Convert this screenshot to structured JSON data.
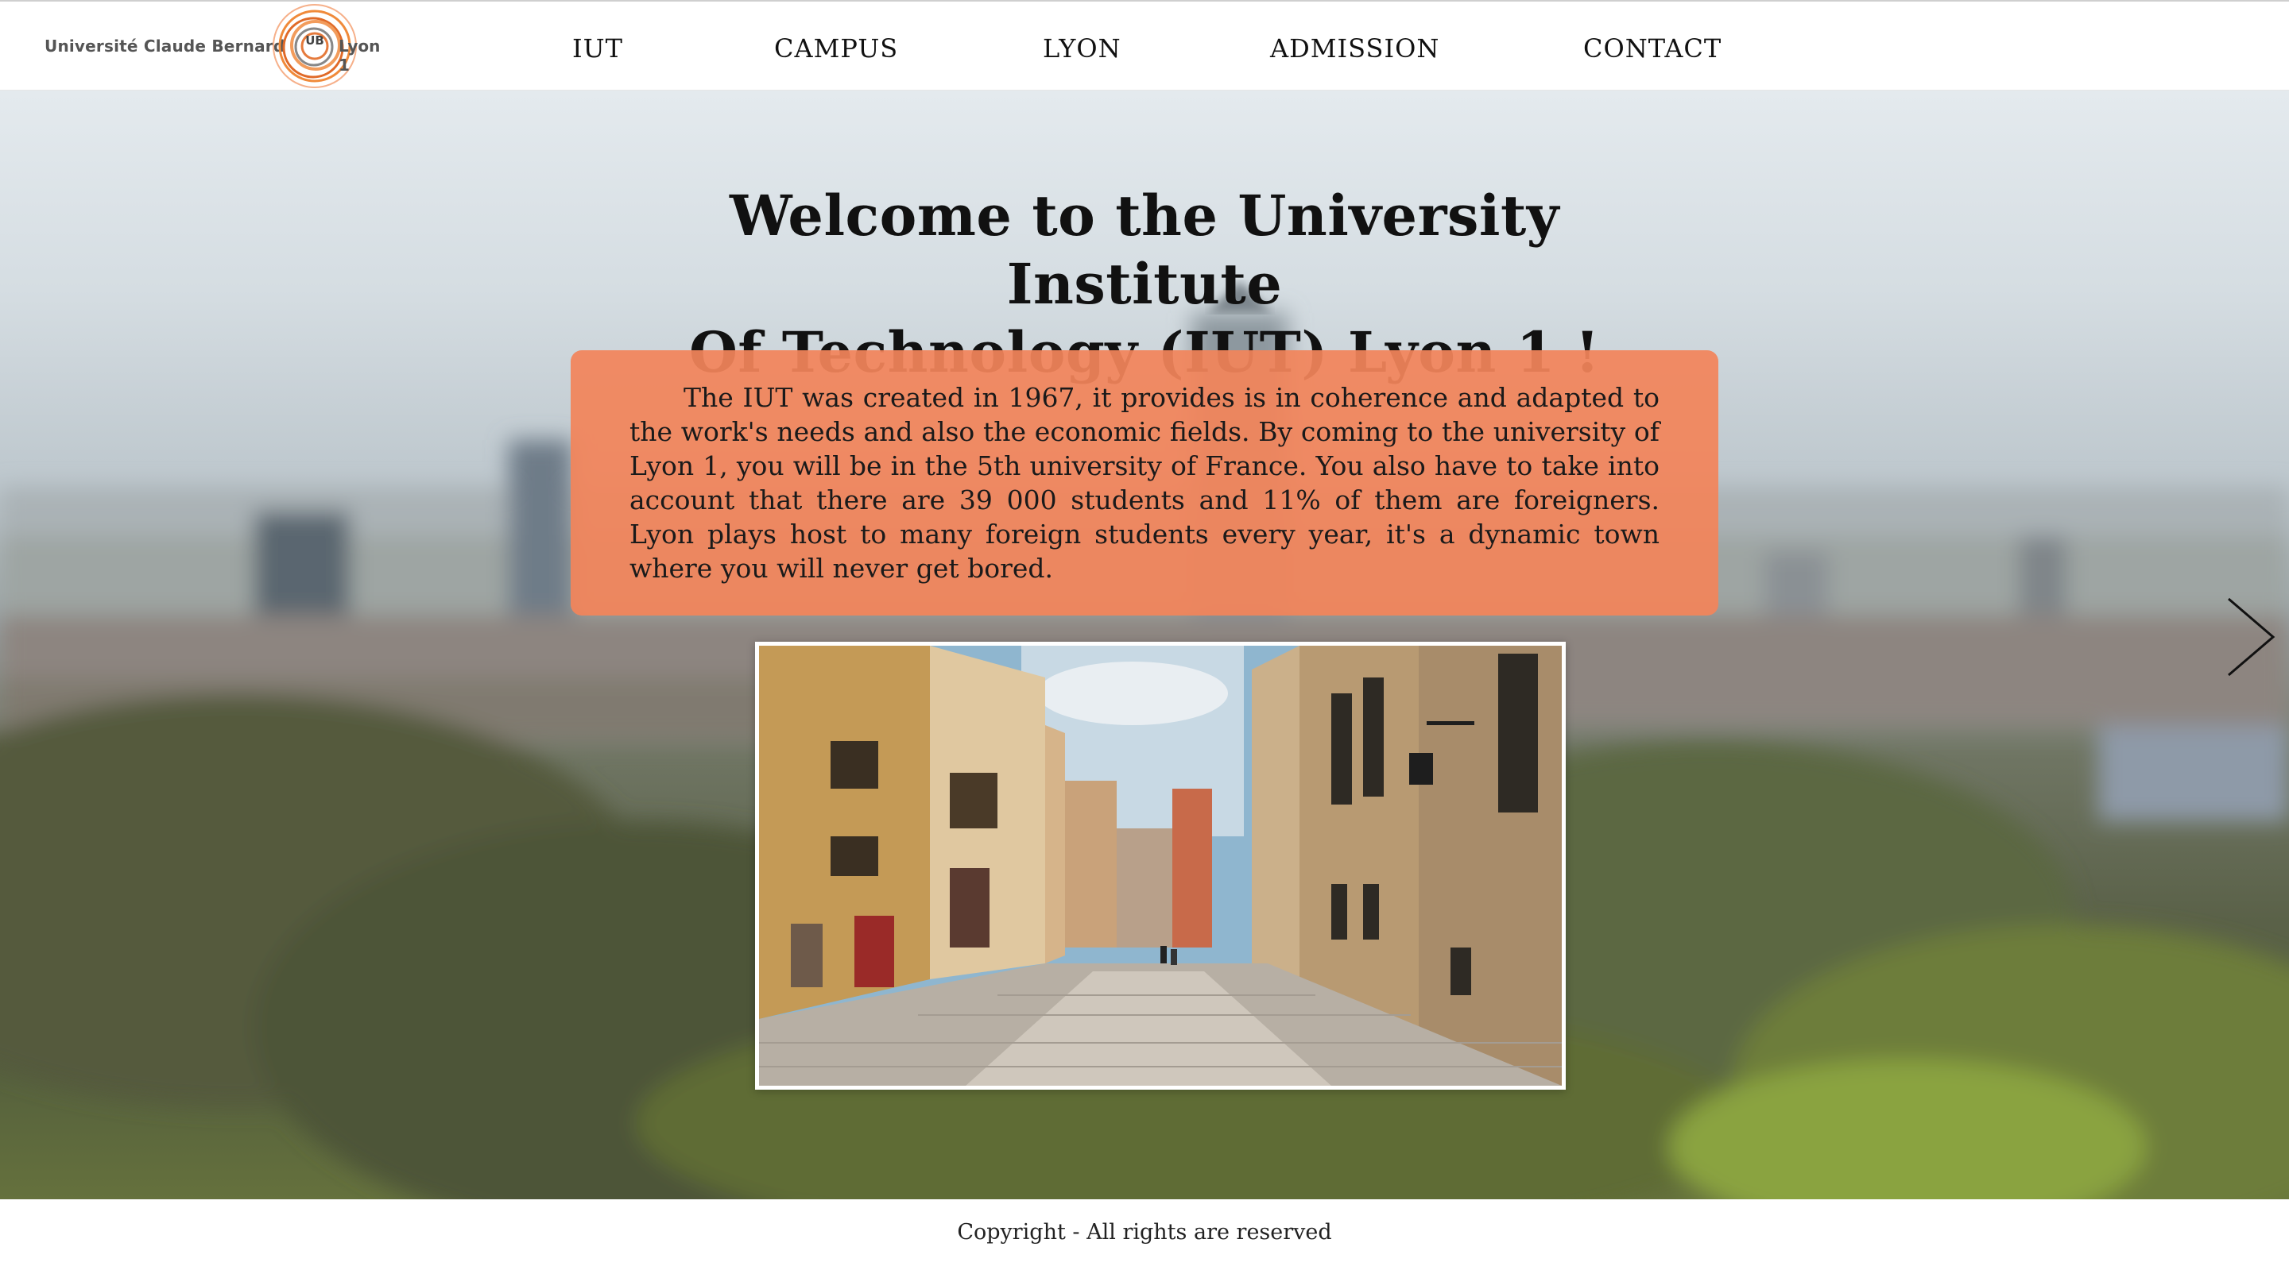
{
  "header": {
    "logo": {
      "left_text": "Université Claude Bernard",
      "emblem_text": "UB",
      "right_text": "Lyon 1"
    },
    "nav": [
      {
        "label": "IUT"
      },
      {
        "label": "CAMPUS"
      },
      {
        "label": "LYON"
      },
      {
        "label": "ADMISSION"
      },
      {
        "label": "CONTACT"
      }
    ]
  },
  "hero": {
    "title_line1": "Welcome to the University Institute",
    "title_line2": "Of Technology (IUT) Lyon 1 !",
    "intro": "The IUT was created in 1967, it provides is in coherence and adapted to the work's needs and also the economic fields. By coming to the university of Lyon 1, you will be in the 5th university of France. You also have to take into account that there are 39 000 students and 11% of them are foreigners. Lyon plays host to many foreign students every year, it's a dynamic town where you will never get bored.",
    "intro_box_color": "#f2845a",
    "next_icon": "chevron-right-icon"
  },
  "footer": {
    "copyright": "Copyright  -  All rights are reserved"
  }
}
